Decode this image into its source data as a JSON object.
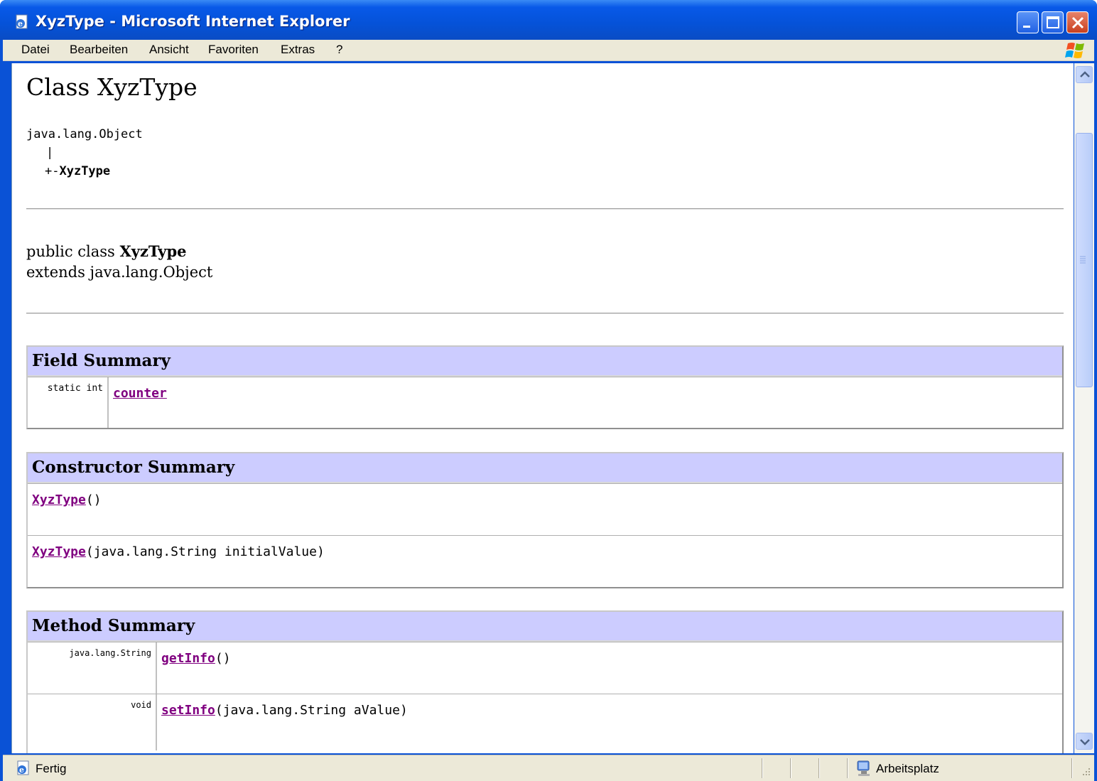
{
  "window": {
    "title": "XyzType - Microsoft Internet Explorer"
  },
  "menu": {
    "items": [
      "Datei",
      "Bearbeiten",
      "Ansicht",
      "Favoriten",
      "Extras",
      "?"
    ]
  },
  "doc": {
    "heading": "Class XyzType",
    "hierarchy": {
      "root": "java.lang.Object",
      "pipe": "|",
      "prefix": "+-",
      "child": "XyzType"
    },
    "declaration": {
      "line1_prefix": "public class ",
      "line1_name": "XyzType",
      "line2": "extends java.lang.Object"
    },
    "field_summary": {
      "title": "Field Summary",
      "rows": [
        {
          "type": "static int",
          "name": "counter",
          "sig": ""
        }
      ]
    },
    "constructor_summary": {
      "title": "Constructor Summary",
      "rows": [
        {
          "name": "XyzType",
          "sig": "()"
        },
        {
          "name": "XyzType",
          "sig": "(java.lang.String initialValue)"
        }
      ]
    },
    "method_summary": {
      "title": "Method Summary",
      "rows": [
        {
          "type": "java.lang.String",
          "name": "getInfo",
          "sig": "()"
        },
        {
          "type": "void",
          "name": "setInfo",
          "sig": "(java.lang.String aValue)"
        }
      ]
    }
  },
  "status": {
    "left": "Fertig",
    "zone": "Arbeitsplatz"
  },
  "colors": {
    "table_header": "#ccccff",
    "link": "#800080",
    "titlebar": "#0552d8"
  }
}
